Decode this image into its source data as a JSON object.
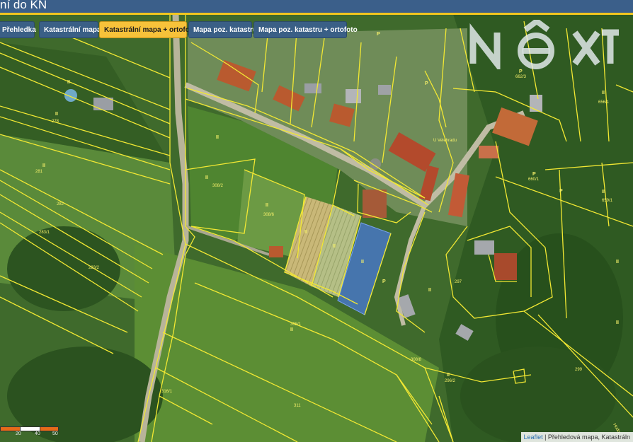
{
  "header": {
    "title": "ní do KN"
  },
  "tabs": [
    {
      "label": "Přehledka",
      "active": false
    },
    {
      "label": "Katastrální mapa",
      "active": false
    },
    {
      "label": "Katastrální mapa + ortofoto",
      "active": true
    },
    {
      "label": "Mapa poz. katastru",
      "active": false
    },
    {
      "label": "Mapa poz. katastru + ortofoto",
      "active": false
    }
  ],
  "logo": {
    "text": "NEXT"
  },
  "scale": {
    "labels": [
      "20",
      "40",
      "50"
    ]
  },
  "attribution": {
    "link": "Leaflet",
    "text": " | Přehledová mapa, Katastráln"
  },
  "map": {
    "road_label": "Hodo",
    "parcel_labels": [
      "308/2",
      "308/1",
      "308/6",
      "308/8",
      "281",
      "282",
      "283/1",
      "283/2",
      "278",
      "279",
      "284/1",
      "296/2",
      "297",
      "299",
      "656/1",
      "656/2",
      "658/1",
      "658/2",
      "659/1",
      "660/1",
      "660/2",
      "662/3",
      "308/6",
      "311",
      "316/1",
      "317"
    ],
    "street_label": "U Velehradu"
  },
  "colors": {
    "parcel_line": "#f2e833",
    "highlight_blue": "#4a7ad8",
    "tab_active": "#f7c23a",
    "tab_default": "#3a5f86"
  }
}
